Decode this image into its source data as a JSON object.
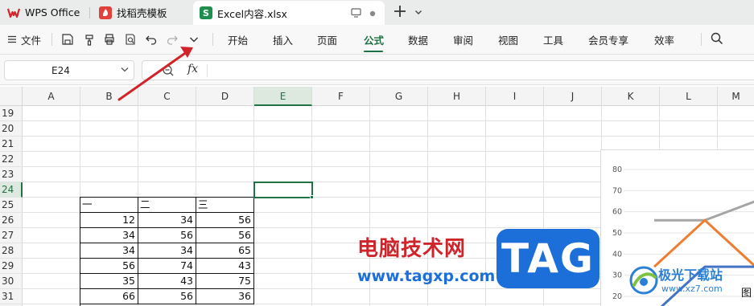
{
  "tabs": [
    {
      "label": "WPS Office",
      "icon": "wps-logo-icon"
    },
    {
      "label": "找稻壳模板",
      "icon": "docer-logo-icon"
    },
    {
      "label": "Excel内容.xlsx",
      "icon": "sheet-logo-icon",
      "active": true
    }
  ],
  "ribbon": {
    "file_label": "文件",
    "menu": [
      "开始",
      "插入",
      "页面",
      "公式",
      "数据",
      "审阅",
      "视图",
      "工具",
      "会员专享",
      "效率"
    ],
    "active_menu": "公式"
  },
  "formula_bar": {
    "name_box": "E24",
    "fx_label": "fx",
    "formula": ""
  },
  "columns": [
    "A",
    "B",
    "C",
    "D",
    "E",
    "F",
    "G",
    "H",
    "I",
    "J",
    "K",
    "L",
    "M"
  ],
  "selected_column": "E",
  "rows": [
    "19",
    "20",
    "21",
    "22",
    "23",
    "24",
    "25",
    "26",
    "27",
    "28",
    "29",
    "30",
    "31"
  ],
  "selected_row": "24",
  "table": {
    "headers": [
      "一",
      "二",
      "三"
    ],
    "rows": [
      [
        "12",
        "34",
        "56"
      ],
      [
        "34",
        "56",
        "56"
      ],
      [
        "34",
        "34",
        "65"
      ],
      [
        "56",
        "74",
        "43"
      ],
      [
        "35",
        "43",
        "75"
      ],
      [
        "66",
        "56",
        "36"
      ]
    ]
  },
  "chart_data": {
    "type": "line",
    "y_ticks": [
      "80",
      "70",
      "60",
      "50",
      "40",
      "30",
      "20"
    ],
    "ylim": [
      20,
      80
    ],
    "series": [
      {
        "color": "#a5a5a5",
        "values": [
          56,
          56,
          65
        ]
      },
      {
        "color": "#ed7d31",
        "values": [
          34,
          56,
          34
        ]
      },
      {
        "color": "#4472c4",
        "values": [
          12,
          34,
          34
        ]
      }
    ],
    "partial_label": "图"
  },
  "overlay": {
    "site_title": "电脑技术网",
    "site_url": "www.tagxp.com",
    "tag_logo": "TAG",
    "xz7_brand": "极光下载站",
    "xz7_url": "www.xz7.com"
  },
  "colors": {
    "accent_green": "#1e7145",
    "annotation_red": "#d0242b",
    "tag_blue": "#1c6fd9"
  }
}
